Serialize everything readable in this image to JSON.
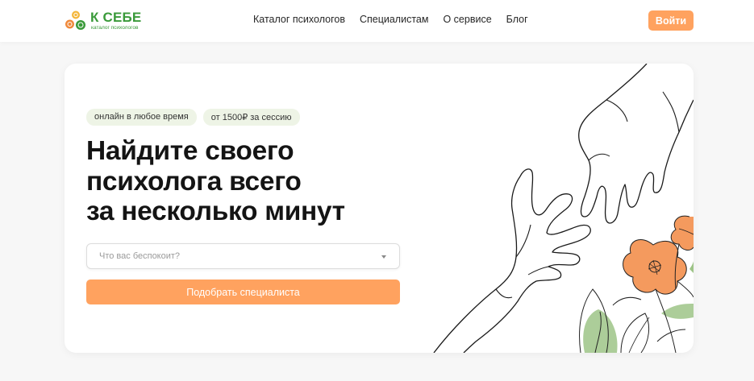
{
  "header": {
    "logo": {
      "title": "К СЕБЕ",
      "subtitle": "каталог психологов"
    },
    "nav": [
      {
        "label": "Каталог психологов"
      },
      {
        "label": "Специалистам"
      },
      {
        "label": "О сервисе"
      },
      {
        "label": "Блог"
      }
    ],
    "login_label": "Войти"
  },
  "hero": {
    "tags": [
      "онлайн в любое время",
      "от 1500₽ за сессию"
    ],
    "headline": [
      "Найдите своего",
      "психолога всего",
      "за несколько минут"
    ],
    "select": {
      "placeholder": "Что вас беспокоит?"
    },
    "cta_label": "Подобрать специалиста"
  },
  "icons": {
    "logo_mark": "circles-logo-icon",
    "caret": "chevron-down-icon",
    "illustration": "hands-flowers-illustration"
  },
  "colors": {
    "accent": "#ffa25f",
    "brand_green": "#3a9a3a",
    "tag_bg": "#eef4e6",
    "flower_orange": "#f49a5e",
    "leaf_green": "#9dc487"
  }
}
